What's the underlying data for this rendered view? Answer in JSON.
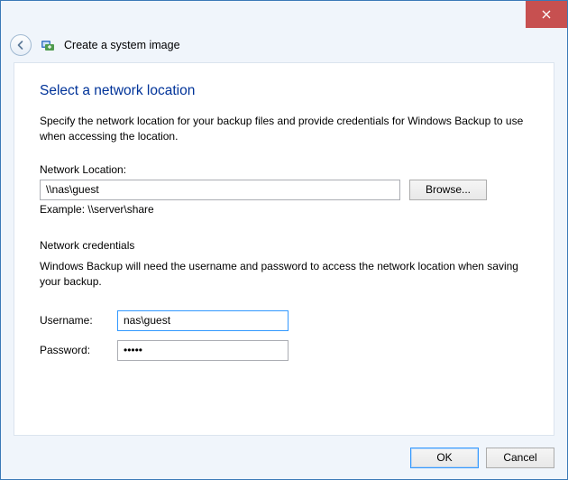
{
  "window": {
    "title": "Create a system image"
  },
  "page": {
    "heading": "Select a network location",
    "description": "Specify the network location for your backup files and provide credentials for Windows Backup to use when accessing the location."
  },
  "network": {
    "label": "Network Location:",
    "value": "\\\\nas\\guest",
    "browse_label": "Browse...",
    "example": "Example: \\\\server\\share"
  },
  "credentials": {
    "section_label": "Network credentials",
    "description": "Windows Backup will need the username and password to access the network location when saving your backup.",
    "username_label": "Username:",
    "username_value": "nas\\guest",
    "password_label": "Password:",
    "password_value": "•••••"
  },
  "buttons": {
    "ok": "OK",
    "cancel": "Cancel"
  }
}
